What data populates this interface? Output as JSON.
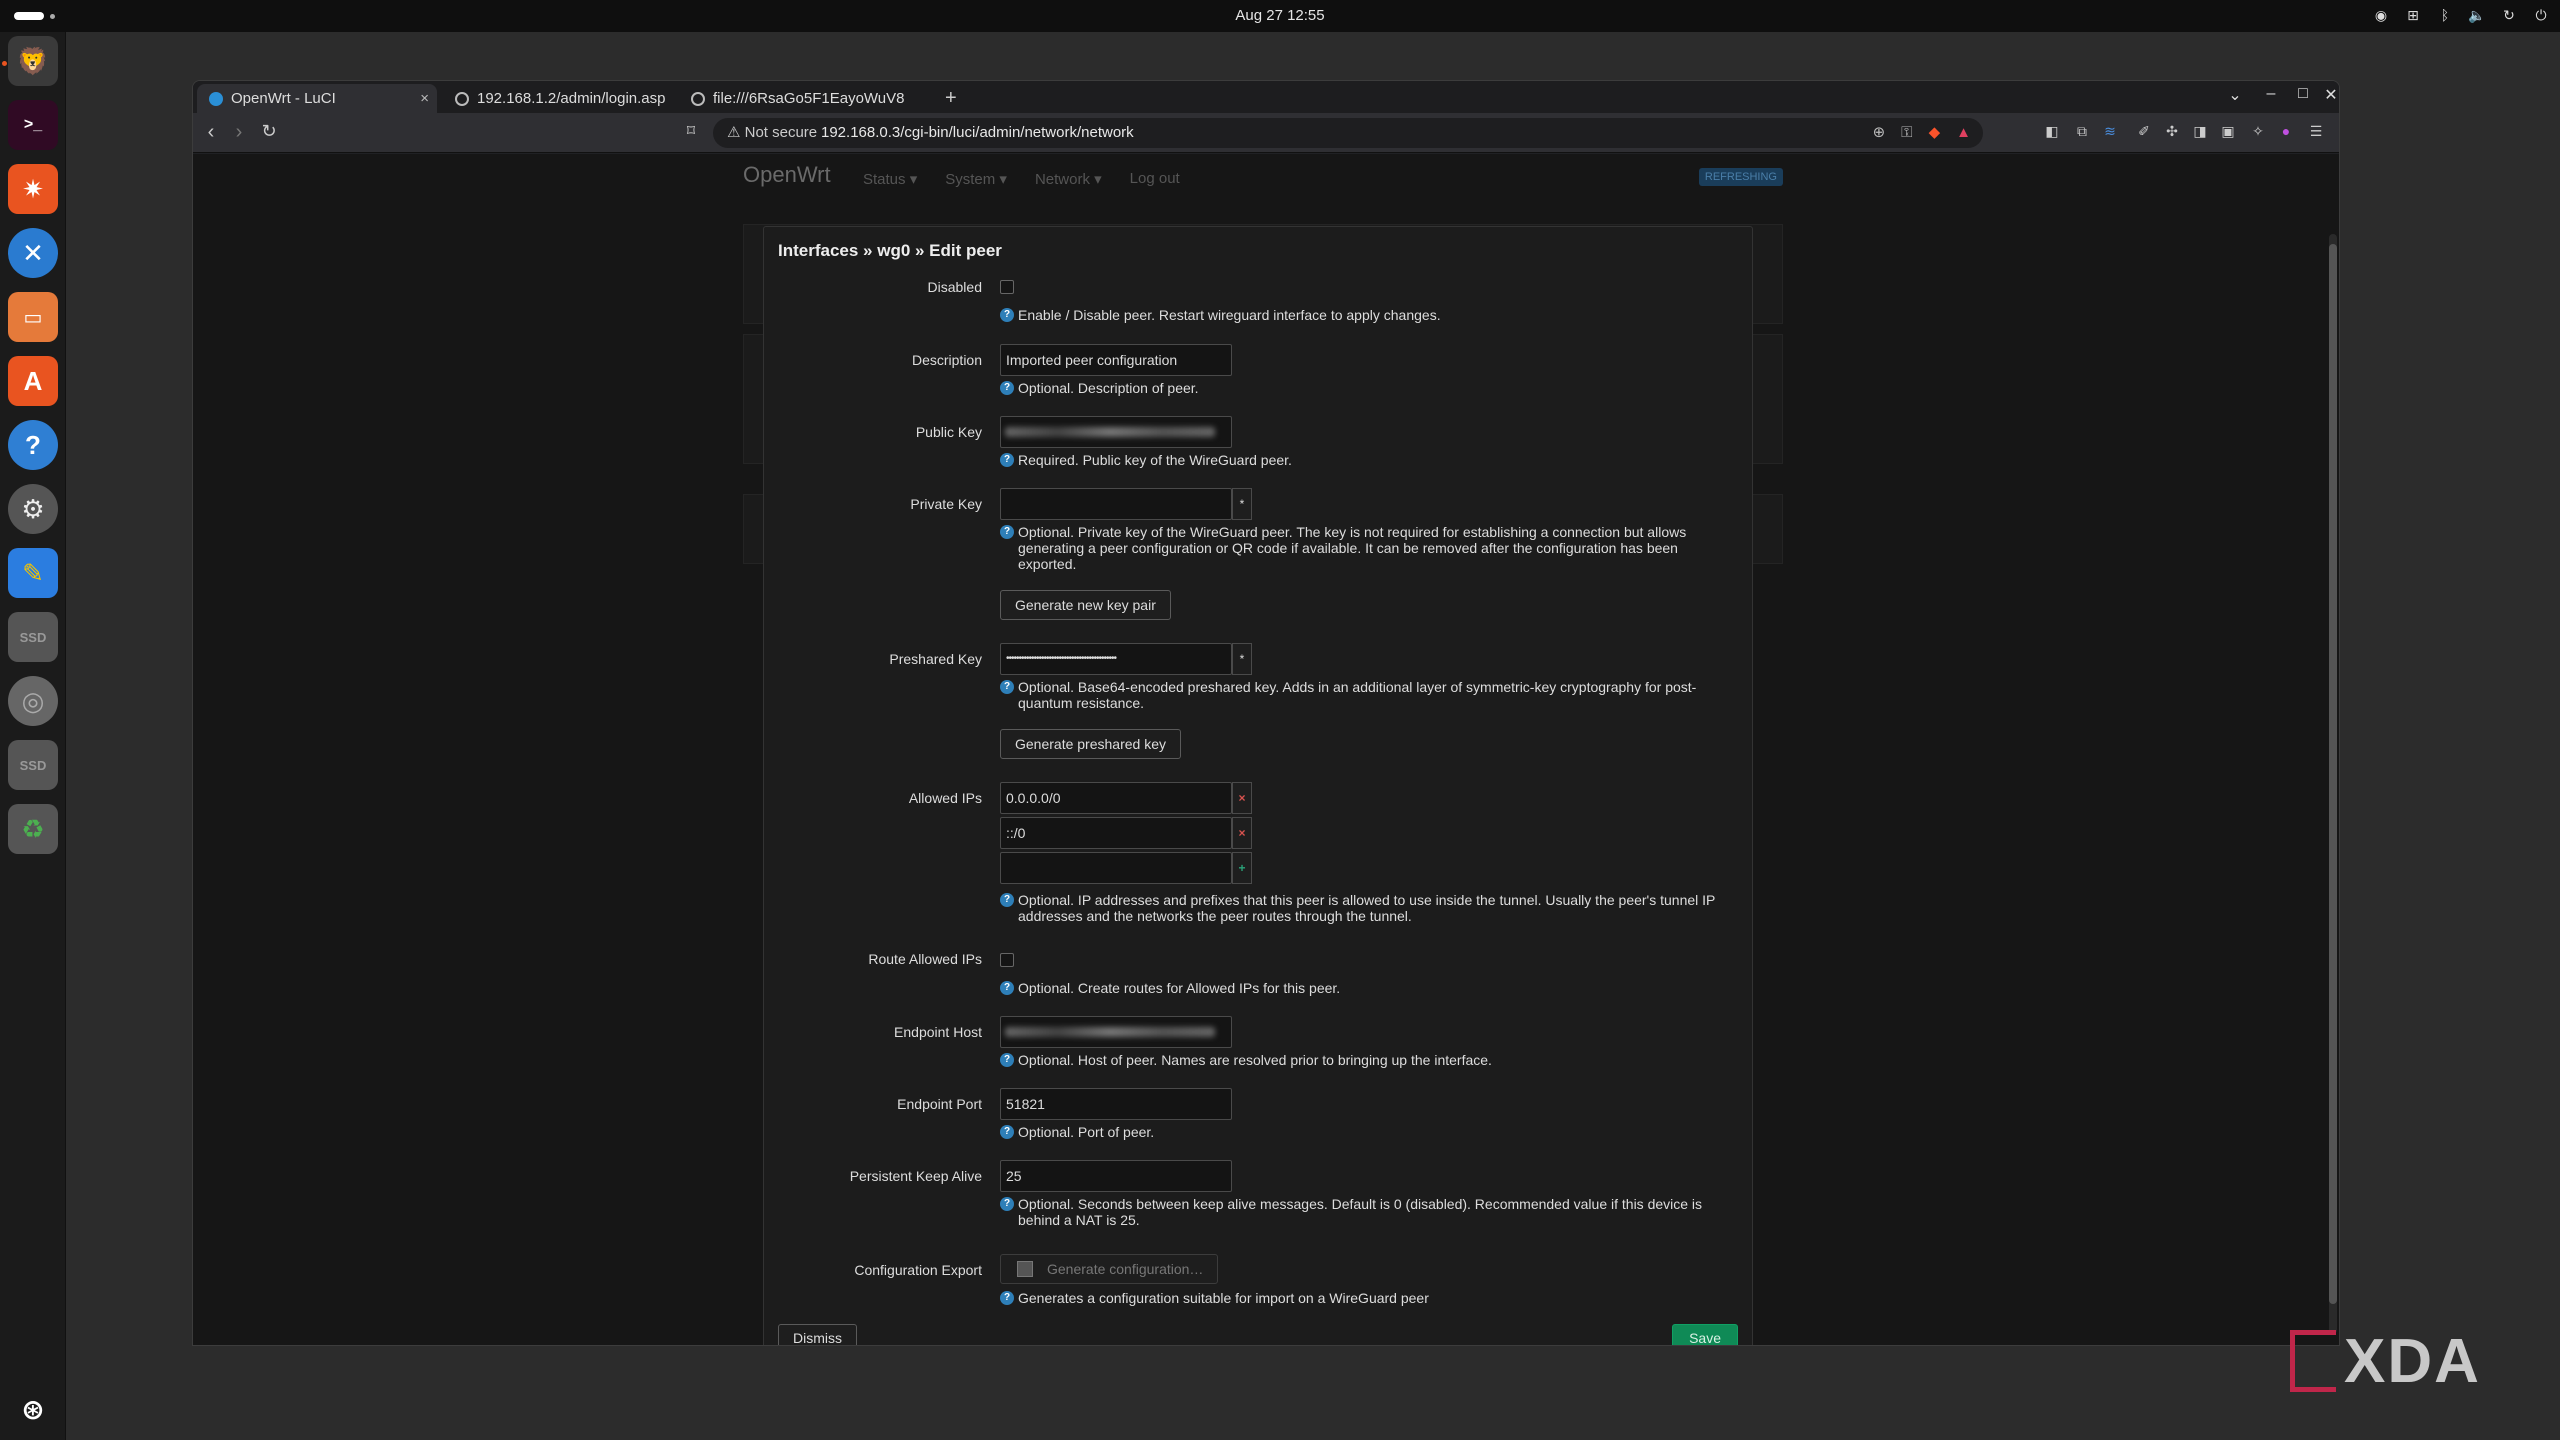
{
  "topbar": {
    "clock": "Aug 27  12:55"
  },
  "tabs": [
    {
      "label": "OpenWrt - LuCI",
      "close": "×"
    },
    {
      "label": "192.168.1.2/admin/login.asp"
    },
    {
      "label": "file:///6RsaGo5F1EayoWuV8"
    }
  ],
  "toolbar": {
    "security": "⚠ Not secure",
    "url": "192.168.0.3/cgi-bin/luci/admin/network/network"
  },
  "luci": {
    "brand": "OpenWrt",
    "menu": [
      "Status ▾",
      "System ▾",
      "Network ▾",
      "Log out"
    ],
    "badge": "REFRESHING"
  },
  "modal": {
    "title": "Interfaces » wg0 » Edit peer",
    "disabled": {
      "label": "Disabled",
      "help": "Enable / Disable peer. Restart wireguard interface to apply changes."
    },
    "description": {
      "label": "Description",
      "value": "Imported peer configuration",
      "help": "Optional. Description of peer."
    },
    "public_key": {
      "label": "Public Key",
      "help": "Required. Public key of the WireGuard peer."
    },
    "private_key": {
      "label": "Private Key",
      "toggle": "*",
      "help": "Optional. Private key of the WireGuard peer. The key is not required for establishing a connection but allows generating a peer configuration or QR code if available. It can be removed after the configuration has been exported.",
      "button": "Generate new key pair"
    },
    "preshared_key": {
      "label": "Preshared Key",
      "value": "••••••••••••••••••••••••••••••••••••••••••••",
      "toggle": "*",
      "help": "Optional. Base64-encoded preshared key. Adds in an additional layer of symmetric-key cryptography for post-quantum resistance.",
      "button": "Generate preshared key"
    },
    "allowed_ips": {
      "label": "Allowed IPs",
      "values": [
        "0.0.0.0/0",
        "::/0"
      ],
      "remove": "×",
      "add": "+",
      "help": "Optional. IP addresses and prefixes that this peer is allowed to use inside the tunnel. Usually the peer's tunnel IP addresses and the networks the peer routes through the tunnel."
    },
    "route_allowed_ips": {
      "label": "Route Allowed IPs",
      "help": "Optional. Create routes for Allowed IPs for this peer."
    },
    "endpoint_host": {
      "label": "Endpoint Host",
      "help": "Optional. Host of peer. Names are resolved prior to bringing up the interface."
    },
    "endpoint_port": {
      "label": "Endpoint Port",
      "value": "51821",
      "help": "Optional. Port of peer."
    },
    "keepalive": {
      "label": "Persistent Keep Alive",
      "value": "25",
      "help": "Optional. Seconds between keep alive messages. Default is 0 (disabled). Recommended value if this device is behind a NAT is 25."
    },
    "config_export": {
      "label": "Configuration Export",
      "button": "Generate configuration…",
      "help": "Generates a configuration suitable for import on a WireGuard peer"
    },
    "dismiss": "Dismiss",
    "save": "Save"
  },
  "watermark": "XDA",
  "colors": {
    "save": "#0f8a56",
    "help_icon": "#2e7fb8",
    "remove": "#d9534f",
    "add": "#2aa37a",
    "ubuntu_orange": "#e95420"
  }
}
